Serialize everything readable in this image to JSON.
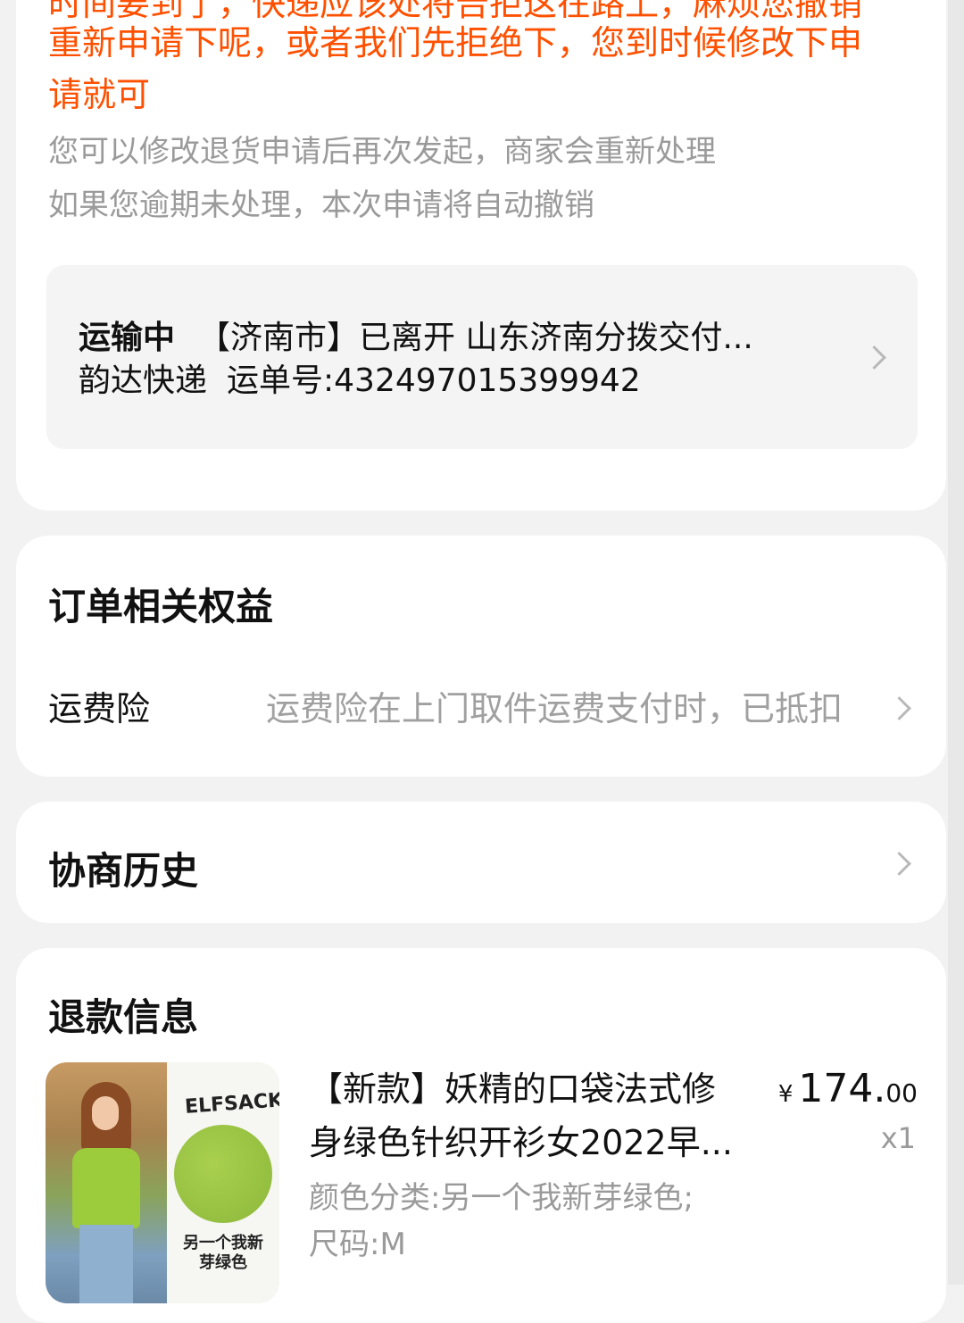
{
  "status_card": {
    "seller_notice_lines": [
      "时间要到了，快递应该处将告拒这在路上，麻烦您撤销",
      "重新申请下呢，或者我们先拒绝下，您到时候修改下申",
      "请就可"
    ],
    "hint_lines": [
      "您可以修改退货申请后再次发起，商家会重新处理",
      "如果您逾期未处理，本次申请将自动撤销"
    ],
    "logistics": {
      "status": "运输中",
      "latest": "【济南市】已离开 山东济南分拨交付...",
      "carrier": "韵达快递",
      "tracking": "运单号:432497015399942"
    }
  },
  "benefits_card": {
    "title": "订单相关权益",
    "row_label": "运费险",
    "row_value": "运费险在上门取件运费支付时，已抵扣"
  },
  "history_card": {
    "title": "协商历史"
  },
  "refund_card": {
    "title": "退款信息",
    "product": {
      "title_line1": "【新款】妖精的口袋法式修",
      "title_line2": "身绿色针织开衫女2022早...",
      "sku_line1": "颜色分类:另一个我新芽绿色;",
      "sku_line2": "尺码:M",
      "price_currency": "¥",
      "price_integer": "174.",
      "price_decimal": "00",
      "quantity": "x1",
      "image_brand": "ELFSACK",
      "image_caption": "另一个我新芽绿色"
    }
  },
  "colors": {
    "notice": "#ff5000",
    "hint": "#9a9a9a",
    "background": "#f2f2f2"
  }
}
